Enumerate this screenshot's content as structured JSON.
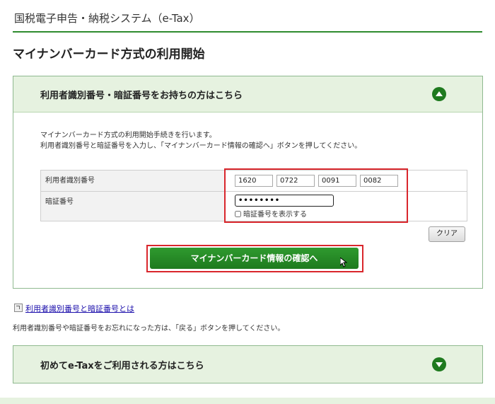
{
  "header": {
    "title": "国税電子申告・納税システム（e-Tax）"
  },
  "page": {
    "title": "マイナンバーカード方式の利用開始"
  },
  "panel": {
    "heading": "利用者識別番号・暗証番号をお持ちの方はこちら",
    "desc_line1": "マイナンバーカード方式の利用開始手続きを行います。",
    "desc_line2": "利用者識別番号と暗証番号を入力し、「マイナンバーカード情報の確認へ」ボタンを押してください。",
    "form": {
      "user_id_label": "利用者識別番号",
      "user_id_values": [
        "1620",
        "0722",
        "0091",
        "0082"
      ],
      "password_label": "暗証番号",
      "password_value": "••••••••",
      "show_password_label": "暗証番号を表示する"
    },
    "clear_label": "クリア",
    "confirm_label": "マイナンバーカード情報の確認へ"
  },
  "help_link": "利用者識別番号と暗証番号とは",
  "note": "利用者識別番号や暗証番号をお忘れになった方は、「戻る」ボタンを押してください。",
  "panel2": {
    "heading": "初めてe-Taxをご利用される方はこちら"
  },
  "colors": {
    "accent": "#1f7a1f",
    "panel_bg": "#e6f2e0",
    "highlight": "#d9262c"
  },
  "icons": {
    "collapse": "chevron-up-icon",
    "expand": "chevron-down-icon"
  }
}
